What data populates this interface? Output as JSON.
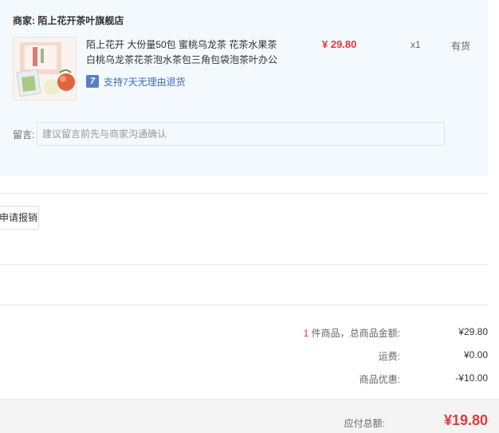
{
  "shop": {
    "label": "商家:",
    "name": "陌上花开茶叶旗舰店"
  },
  "product": {
    "title": "陌上花开 大份量50包 蜜桃乌龙茶 花茶水果茶白桃乌龙茶花茶泡水茶包三角包袋泡茶叶办公",
    "thumb_icon": "tea-package-image",
    "return_policy": "支持7天无理由退货",
    "return_icon_glyph": "7",
    "price": "¥ 29.80",
    "quantity": "x1",
    "stock": "有货"
  },
  "message": {
    "label": "留言:",
    "placeholder": "建议留言前先与商家沟通确认"
  },
  "invoice": {
    "button_label": "申请报销"
  },
  "summary": {
    "count": "1",
    "count_suffix": " 件商品，总商品金额:",
    "goods_total": "¥29.80",
    "shipping_label": "运费:",
    "shipping": "¥0.00",
    "discount_label": "商品优惠:",
    "discount": "-¥10.00"
  },
  "total": {
    "label": "应付总额:",
    "value": "¥19.80"
  },
  "colors": {
    "accent_red": "#e4393c",
    "shop_bg": "#f3f9fd",
    "link_blue": "#3d6bbd"
  }
}
